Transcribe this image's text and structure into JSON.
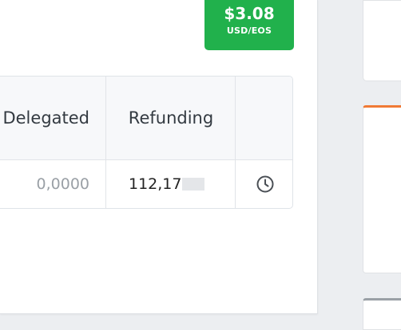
{
  "price_badge": {
    "price": "$3.08",
    "unit": "USD/EOS"
  },
  "table": {
    "headers": {
      "delegated": "Delegated",
      "refunding": "Refunding"
    },
    "row": {
      "delegated": "0,0000",
      "refunding": "112,17"
    },
    "action_icon": "clock-icon"
  },
  "colors": {
    "badge_green": "#21b14c",
    "card_accent_orange": "#f07a35",
    "card_accent_gray": "#9aa0a6"
  }
}
